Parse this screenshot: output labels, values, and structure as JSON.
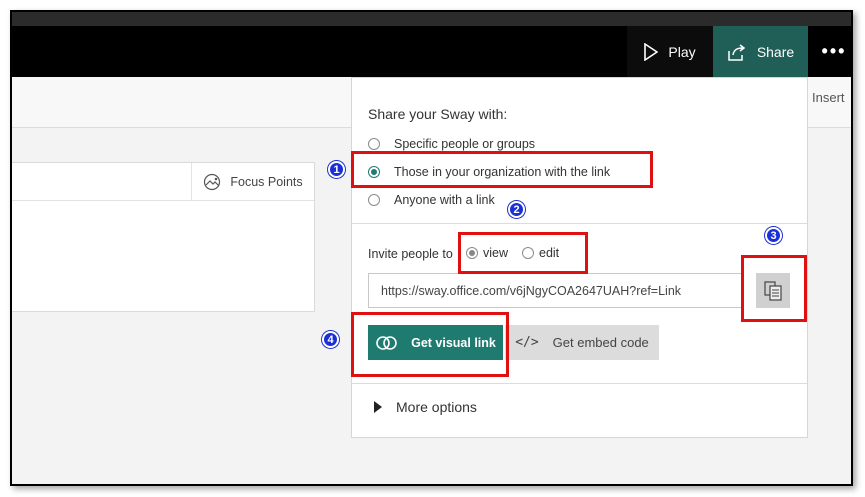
{
  "topbar": {
    "play_label": "Play",
    "share_label": "Share",
    "more_label": "•••"
  },
  "ribbon": {
    "insert_label": "Insert"
  },
  "card": {
    "focus_points_label": "Focus Points"
  },
  "share_panel": {
    "title": "Share your Sway with:",
    "options": [
      {
        "label": "Specific people or groups",
        "selected": false
      },
      {
        "label": "Those in your organization with the link",
        "selected": true
      },
      {
        "label": "Anyone with a link",
        "selected": false
      }
    ],
    "invite_label": "Invite people to",
    "permissions": [
      {
        "label": "view",
        "selected": true
      },
      {
        "label": "edit",
        "selected": false
      }
    ],
    "link_url": "https://sway.office.com/v6jNgyCOA2647UAH?ref=Link",
    "get_visual_link_label": "Get visual link",
    "get_embed_code_label": "Get embed code",
    "embed_glyph": "</>",
    "more_options_label": "More options"
  },
  "annotations": {
    "markers": [
      "1",
      "2",
      "3",
      "4"
    ],
    "highlight_color": "#e01010",
    "marker_color": "#1a2fd6"
  },
  "colors": {
    "accent": "#1f7a6f",
    "share_bg": "#1f5f58",
    "topbar_bg": "#000000"
  }
}
